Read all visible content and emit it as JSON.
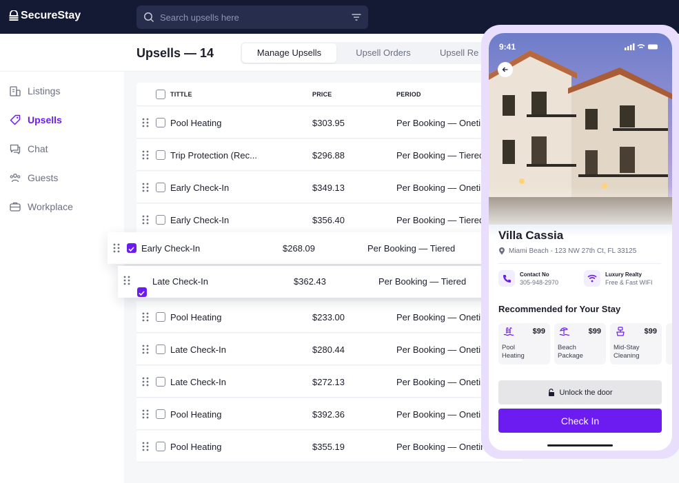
{
  "brand": {
    "name": "SecureStay"
  },
  "search": {
    "placeholder": "Search upsells here"
  },
  "page": {
    "title": "Upsells — 14"
  },
  "tabs": [
    {
      "label": "Manage Upsells",
      "active": true
    },
    {
      "label": "Upsell Orders",
      "active": false
    },
    {
      "label": "Upsell Re",
      "active": false
    }
  ],
  "sidebar": {
    "items": [
      {
        "label": "Listings",
        "icon": "building-icon",
        "active": false
      },
      {
        "label": "Upsells",
        "icon": "tag-icon",
        "active": true
      },
      {
        "label": "Chat",
        "icon": "chat-icon",
        "active": false
      },
      {
        "label": "Guests",
        "icon": "users-icon",
        "active": false
      },
      {
        "label": "Workplace",
        "icon": "briefcase-icon",
        "active": false
      }
    ]
  },
  "table": {
    "columns": [
      "TITTLE",
      "PRICE",
      "PERIOD"
    ],
    "rows": [
      {
        "title": "Pool Heating",
        "price": "$303.95",
        "period": "Per Booking — Onetin"
      },
      {
        "title": "Trip Protection (Rec...",
        "price": "$296.88",
        "period": "Per Booking — Tiered"
      },
      {
        "title": "Early Check-In",
        "price": "$349.13",
        "period": "Per Booking — Onetin"
      },
      {
        "title": "Early Check-In",
        "price": "$356.40",
        "period": "Per Booking — Tiered"
      },
      {
        "title": "Pool Heating",
        "price": "$233.00",
        "period": "Per Booking — Onetin"
      },
      {
        "title": "Late Check-In",
        "price": "$280.44",
        "period": "Per Booking — Onetin"
      },
      {
        "title": "Late Check-In",
        "price": "$272.13",
        "period": "Per Booking — Onetin"
      },
      {
        "title": "Pool Heating",
        "price": "$392.36",
        "period": "Per Booking — Onetin"
      },
      {
        "title": "Pool Heating",
        "price": "$355.19",
        "period": "Per Booking — Onetin"
      }
    ],
    "dragged": [
      {
        "title": "Early Check-In",
        "price": "$268.09",
        "period": "Per Booking — Tiered",
        "checked": true
      },
      {
        "title": "Late Check-In",
        "price": "$362.43",
        "period": "Per Booking — Tiered",
        "checked": true
      }
    ]
  },
  "phone": {
    "time": "9:41",
    "villa_name": "Villa Cassia",
    "address": "Miami Beach - 123 NW 27th Ct, FL 33125",
    "contact": {
      "title": "Contact No",
      "value": "305-948-2970"
    },
    "wifi": {
      "title": "Luxury Realty",
      "value": "Free & Fast WIFI"
    },
    "recommended_title": "Recommended for Your Stay",
    "recommended": [
      {
        "name": "Pool\nHeating",
        "price": "$99"
      },
      {
        "name": "Beach\nPackage",
        "price": "$99"
      },
      {
        "name": "Mid-Stay\nCleaning",
        "price": "$99"
      }
    ],
    "unlock_label": "Unlock the door",
    "checkin_label": "Check In"
  },
  "colors": {
    "accent": "#6c1cf0",
    "dark": "#141a33"
  }
}
